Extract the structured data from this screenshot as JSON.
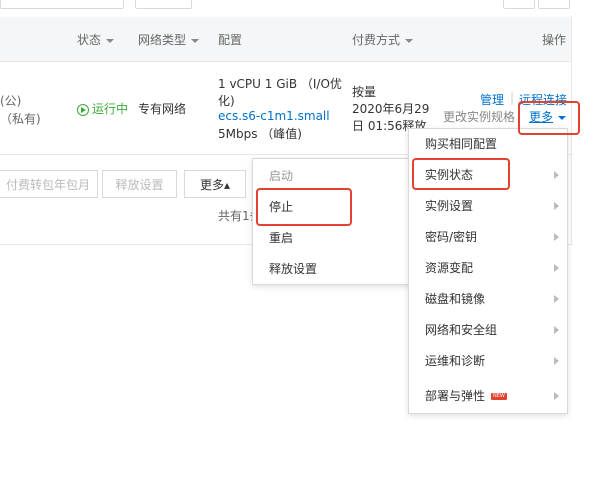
{
  "table": {
    "headers": {
      "status": "状态",
      "network": "网络类型",
      "config": "配置",
      "billing": "付费方式",
      "actions": "操作"
    },
    "row": {
      "ip_public": "(公)",
      "ip_private": "（私有)",
      "status": "运行中",
      "network": "专有网络",
      "config_line1": "1 vCPU 1 GiB （I/O优",
      "config_line2": "化)",
      "config_spec": "ecs.s6-c1m1.small",
      "config_bandwidth": "5Mbps （峰值)",
      "billing_line1": "按量",
      "billing_line2": "2020年6月29",
      "billing_line3": "日 01:56释放",
      "action_manage": "管理",
      "action_divider": "|",
      "action_remote": "远程连接",
      "action_change_spec": "更改实例规格",
      "action_more": "更多"
    }
  },
  "bottom_bar": {
    "convert_btn": "付费转包年包月",
    "release_btn": "释放设置",
    "more_btn": "更多▴",
    "total_text": "共有1条"
  },
  "status_menu": {
    "items": [
      {
        "label": "启动",
        "disabled": true
      },
      {
        "label": "停止",
        "disabled": false
      },
      {
        "label": "重启",
        "disabled": false
      },
      {
        "label": "释放设置",
        "disabled": false
      }
    ]
  },
  "more_menu": {
    "items": [
      {
        "label": "购买相同配置"
      },
      {
        "label": "实例状态"
      },
      {
        "label": "实例设置"
      },
      {
        "label": "密码/密钥"
      },
      {
        "label": "资源变配"
      },
      {
        "label": "磁盘和镜像"
      },
      {
        "label": "网络和安全组"
      },
      {
        "label": "运维和诊断"
      },
      {
        "label": "部署与弹性",
        "badge": "NEW"
      }
    ]
  },
  "colors": {
    "accent": "#0070cc",
    "running": "#3aab3a",
    "highlight": "#e0432f"
  }
}
